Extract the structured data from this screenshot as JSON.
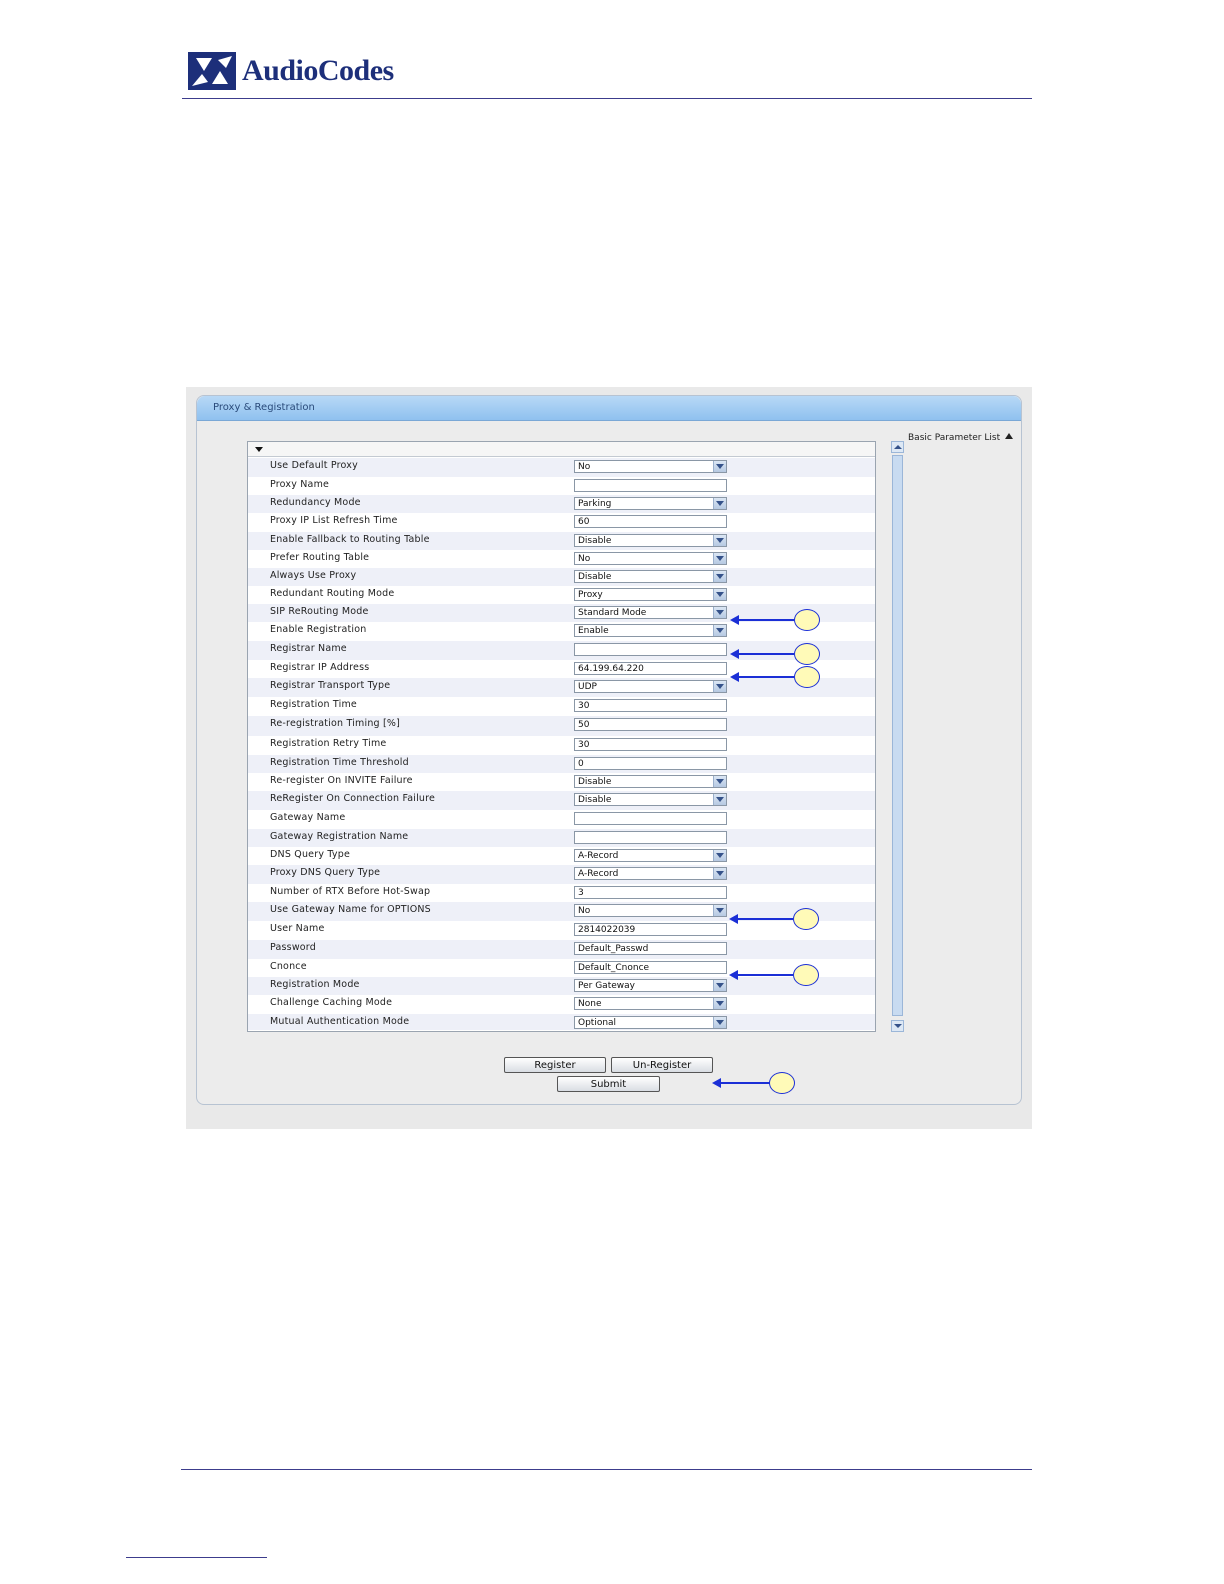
{
  "header": {
    "brand": "AudioCodes"
  },
  "window": {
    "title": "Proxy & Registration",
    "basic_list_label": "Basic Parameter List"
  },
  "rows": [
    {
      "label": "Use Default Proxy",
      "value": "No",
      "type": "select"
    },
    {
      "label": "Proxy Name",
      "value": "",
      "type": "text"
    },
    {
      "label": "Redundancy Mode",
      "value": "Parking",
      "type": "select"
    },
    {
      "label": "Proxy IP List Refresh Time",
      "value": "60",
      "type": "text"
    },
    {
      "label": "Enable Fallback to Routing Table",
      "value": "Disable",
      "type": "select"
    },
    {
      "label": "Prefer Routing Table",
      "value": "No",
      "type": "select"
    },
    {
      "label": "Always Use Proxy",
      "value": "Disable",
      "type": "select"
    },
    {
      "label": "Redundant Routing Mode",
      "value": "Proxy",
      "type": "select"
    },
    {
      "label": "SIP ReRouting Mode",
      "value": "Standard Mode",
      "type": "select"
    },
    {
      "label": "Enable Registration",
      "value": "Enable",
      "type": "select"
    },
    {
      "label": "Registrar Name",
      "value": "",
      "type": "text"
    },
    {
      "label": "Registrar IP Address",
      "value": "64.199.64.220",
      "type": "text"
    },
    {
      "label": "Registrar Transport Type",
      "value": "UDP",
      "type": "select"
    },
    {
      "label": "Registration Time",
      "value": "30",
      "type": "text"
    },
    {
      "label": "Re-registration Timing [%]",
      "value": "50",
      "type": "text"
    },
    {
      "label": "Registration Retry Time",
      "value": "30",
      "type": "text"
    },
    {
      "label": "Registration Time Threshold",
      "value": "0",
      "type": "text"
    },
    {
      "label": "Re-register On INVITE Failure",
      "value": "Disable",
      "type": "select"
    },
    {
      "label": "ReRegister On Connection Failure",
      "value": "Disable",
      "type": "select"
    },
    {
      "label": "Gateway Name",
      "value": "",
      "type": "text"
    },
    {
      "label": "Gateway Registration Name",
      "value": "",
      "type": "text"
    },
    {
      "label": "DNS Query Type",
      "value": "A-Record",
      "type": "select"
    },
    {
      "label": "Proxy DNS Query Type",
      "value": "A-Record",
      "type": "select"
    },
    {
      "label": "Number of RTX Before Hot-Swap",
      "value": "3",
      "type": "text"
    },
    {
      "label": "Use Gateway Name for OPTIONS",
      "value": "No",
      "type": "select"
    },
    {
      "label": "User Name",
      "value": "2814022039",
      "type": "text"
    },
    {
      "label": "Password",
      "value": "Default_Passwd",
      "type": "text"
    },
    {
      "label": "Cnonce",
      "value": "Default_Cnonce",
      "type": "text"
    },
    {
      "label": "Registration Mode",
      "value": "Per Gateway",
      "type": "select"
    },
    {
      "label": "Challenge Caching Mode",
      "value": "None",
      "type": "select"
    },
    {
      "label": "Mutual Authentication Mode",
      "value": "Optional",
      "type": "select"
    }
  ],
  "buttons": {
    "register": "Register",
    "unregister": "Un-Register",
    "submit": "Submit"
  },
  "colors": {
    "callout": "#1b2fd6",
    "callout_fill": "#fffab8",
    "title_bar": "#a9d0f5"
  }
}
